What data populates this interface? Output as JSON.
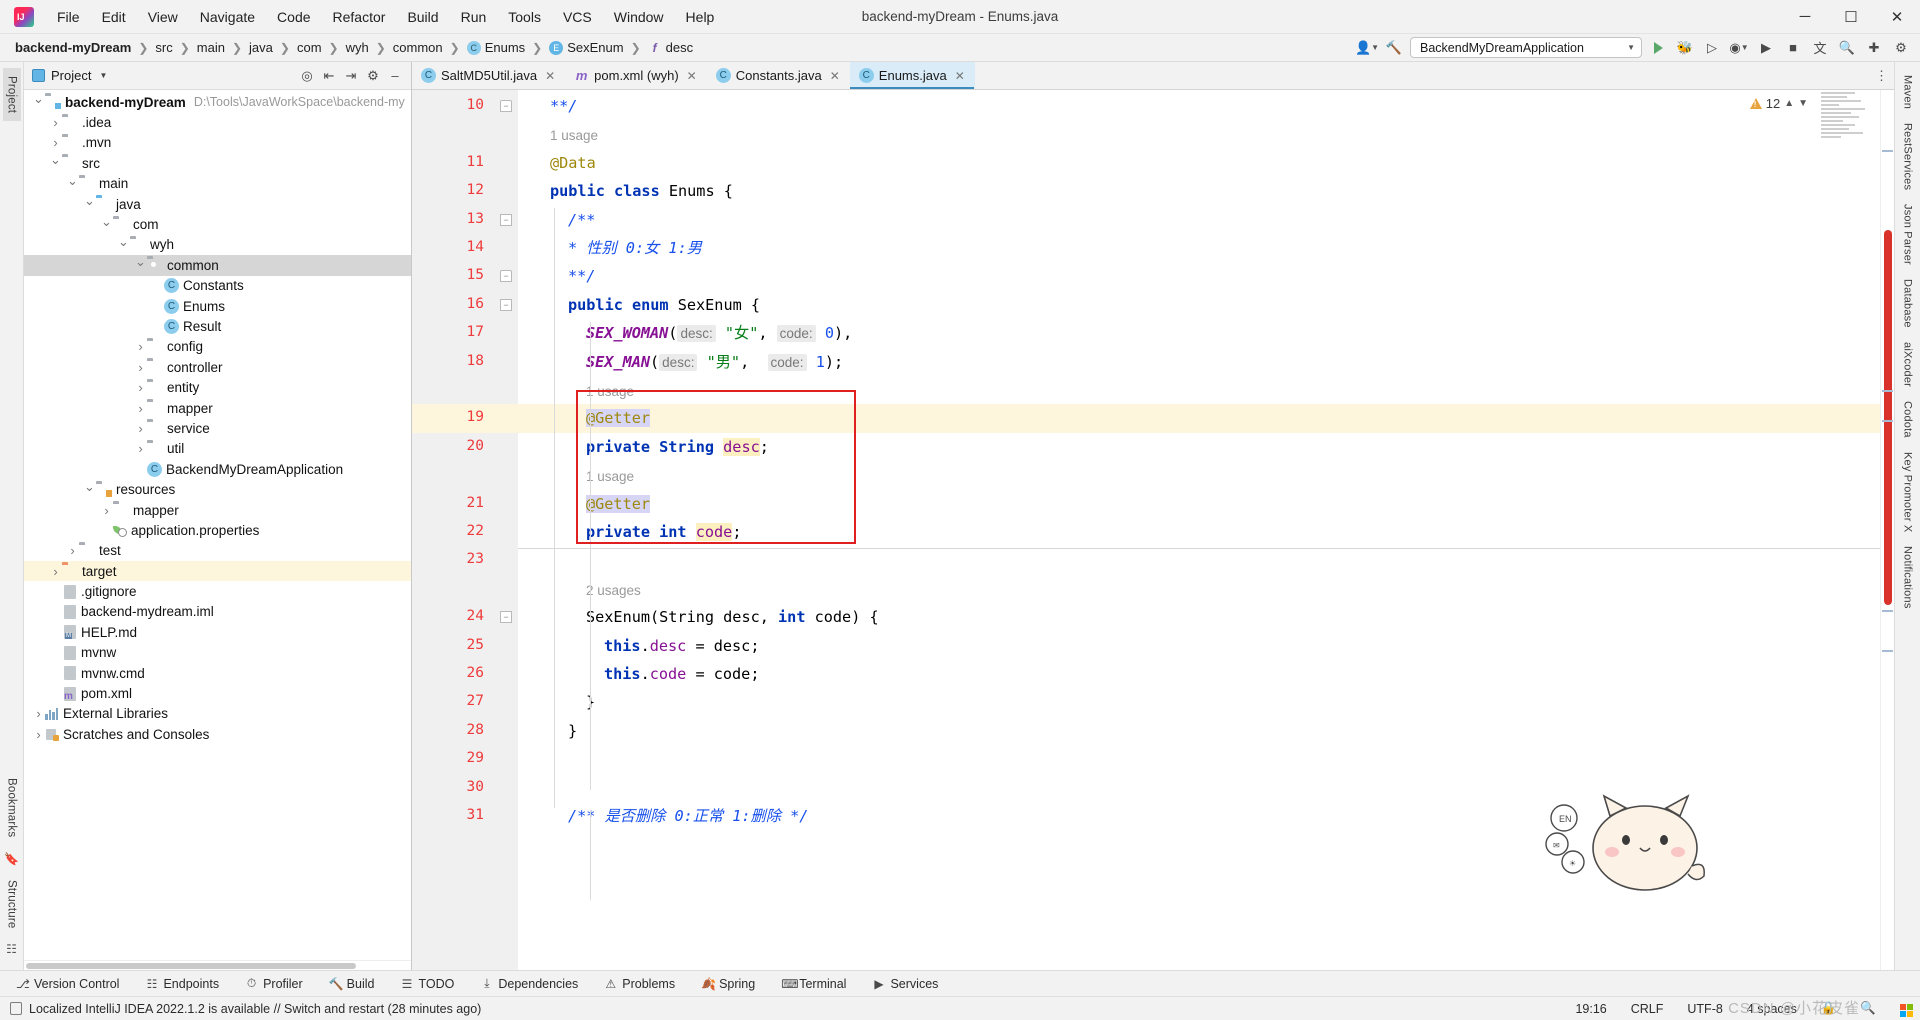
{
  "window": {
    "title": "backend-myDream - Enums.java",
    "minimize": "—",
    "maximize": "☐",
    "close": "✕"
  },
  "menu": [
    {
      "label": "File"
    },
    {
      "label": "Edit"
    },
    {
      "label": "View"
    },
    {
      "label": "Navigate"
    },
    {
      "label": "Code"
    },
    {
      "label": "Refactor"
    },
    {
      "label": "Build"
    },
    {
      "label": "Run"
    },
    {
      "label": "Tools"
    },
    {
      "label": "VCS"
    },
    {
      "label": "Window"
    },
    {
      "label": "Help"
    }
  ],
  "breadcrumb": [
    {
      "label": "backend-myDream",
      "icon": "",
      "bold": true
    },
    {
      "label": "src",
      "icon": ""
    },
    {
      "label": "main",
      "icon": ""
    },
    {
      "label": "java",
      "icon": ""
    },
    {
      "label": "com",
      "icon": ""
    },
    {
      "label": "wyh",
      "icon": ""
    },
    {
      "label": "common",
      "icon": ""
    },
    {
      "label": "Enums",
      "icon": "c"
    },
    {
      "label": "SexEnum",
      "icon": "e"
    },
    {
      "label": "desc",
      "icon": "f"
    }
  ],
  "toolbar": {
    "run_config": "BackendMyDreamApplication",
    "account_icon": "user-icon",
    "hammer_icon": "build-icon",
    "search_icon": "search-icon",
    "translate_icon": "translate-icon",
    "settings_icon": "gear-icon"
  },
  "project_panel": {
    "title": "Project",
    "root_label": "backend-myDream",
    "root_path": "D:\\Tools\\JavaWorkSpace\\backend-my",
    "tree": [
      {
        "label": "backend-myDream",
        "depth": 0,
        "arrow": "open",
        "icon": "folder-module",
        "bold": true,
        "path": "D:\\Tools\\JavaWorkSpace\\backend-my"
      },
      {
        "label": ".idea",
        "depth": 1,
        "arrow": "closed",
        "icon": "folder"
      },
      {
        "label": ".mvn",
        "depth": 1,
        "arrow": "closed",
        "icon": "folder"
      },
      {
        "label": "src",
        "depth": 1,
        "arrow": "open",
        "icon": "folder"
      },
      {
        "label": "main",
        "depth": 2,
        "arrow": "open",
        "icon": "folder"
      },
      {
        "label": "java",
        "depth": 3,
        "arrow": "open",
        "icon": "folder-source"
      },
      {
        "label": "com",
        "depth": 4,
        "arrow": "open",
        "icon": "folder-package"
      },
      {
        "label": "wyh",
        "depth": 5,
        "arrow": "open",
        "icon": "folder-package"
      },
      {
        "label": "common",
        "depth": 6,
        "arrow": "open",
        "icon": "folder-package",
        "selected": true
      },
      {
        "label": "Constants",
        "depth": 7,
        "arrow": "none",
        "icon": "class"
      },
      {
        "label": "Enums",
        "depth": 7,
        "arrow": "none",
        "icon": "class"
      },
      {
        "label": "Result",
        "depth": 7,
        "arrow": "none",
        "icon": "class"
      },
      {
        "label": "config",
        "depth": 6,
        "arrow": "closed",
        "icon": "folder-package"
      },
      {
        "label": "controller",
        "depth": 6,
        "arrow": "closed",
        "icon": "folder-package"
      },
      {
        "label": "entity",
        "depth": 6,
        "arrow": "closed",
        "icon": "folder-package"
      },
      {
        "label": "mapper",
        "depth": 6,
        "arrow": "closed",
        "icon": "folder-package"
      },
      {
        "label": "service",
        "depth": 6,
        "arrow": "closed",
        "icon": "folder-package"
      },
      {
        "label": "util",
        "depth": 6,
        "arrow": "closed",
        "icon": "folder-package"
      },
      {
        "label": "BackendMyDreamApplication",
        "depth": 6,
        "arrow": "none",
        "icon": "class-run"
      },
      {
        "label": "resources",
        "depth": 3,
        "arrow": "open",
        "icon": "folder-resources"
      },
      {
        "label": "mapper",
        "depth": 4,
        "arrow": "closed",
        "icon": "folder"
      },
      {
        "label": "application.properties",
        "depth": 4,
        "arrow": "none",
        "icon": "spring-properties"
      },
      {
        "label": "test",
        "depth": 2,
        "arrow": "closed",
        "icon": "folder"
      },
      {
        "label": "target",
        "depth": 1,
        "arrow": "closed",
        "icon": "folder-target",
        "highlight": true
      },
      {
        "label": ".gitignore",
        "depth": 1,
        "arrow": "none",
        "icon": "gitignore"
      },
      {
        "label": "backend-mydream.iml",
        "depth": 1,
        "arrow": "none",
        "icon": "iml"
      },
      {
        "label": "HELP.md",
        "depth": 1,
        "arrow": "none",
        "icon": "markdown"
      },
      {
        "label": "mvnw",
        "depth": 1,
        "arrow": "none",
        "icon": "file"
      },
      {
        "label": "mvnw.cmd",
        "depth": 1,
        "arrow": "none",
        "icon": "file"
      },
      {
        "label": "pom.xml",
        "depth": 1,
        "arrow": "none",
        "icon": "maven"
      },
      {
        "label": "External Libraries",
        "depth": 0,
        "arrow": "closed",
        "icon": "library"
      },
      {
        "label": "Scratches and Consoles",
        "depth": 0,
        "arrow": "closed",
        "icon": "scratch"
      }
    ]
  },
  "left_rail": {
    "items": [
      {
        "label": "Project",
        "selected": true
      },
      {
        "label": "Bookmarks"
      },
      {
        "label": "Structure"
      }
    ]
  },
  "right_rail": {
    "items": [
      {
        "label": "Maven"
      },
      {
        "label": "RestServices"
      },
      {
        "label": "Json Parser"
      },
      {
        "label": "Database"
      },
      {
        "label": "aiXcoder"
      },
      {
        "label": "Codota"
      },
      {
        "label": "Key Promoter X"
      },
      {
        "label": "Notifications"
      }
    ]
  },
  "editor_tabs": [
    {
      "label": "SaltMD5Util.java",
      "icon": "class",
      "active": false
    },
    {
      "label": "pom.xml (wyh)",
      "icon": "maven",
      "active": false
    },
    {
      "label": "Constants.java",
      "icon": "class",
      "active": false
    },
    {
      "label": "Enums.java",
      "icon": "class",
      "active": true
    }
  ],
  "editor": {
    "warning_count": "12",
    "file": "Enums.java",
    "first_line": 10,
    "lines": [
      {
        "num": 10,
        "indent": 1,
        "fold": "up",
        "segments": [
          {
            "t": "**/",
            "c": "cmt"
          }
        ]
      },
      {
        "num": null,
        "hint": "1 usage",
        "indent": 1
      },
      {
        "num": 11,
        "indent": 1,
        "segments": [
          {
            "t": "@Data",
            "c": "ann"
          }
        ]
      },
      {
        "num": 12,
        "indent": 1,
        "segments": [
          {
            "t": "public class ",
            "c": "kw"
          },
          {
            "t": "Enums ",
            "c": "cls"
          },
          {
            "t": "{",
            "c": "cls"
          }
        ]
      },
      {
        "num": 13,
        "indent": 2,
        "fold": "down",
        "segments": [
          {
            "t": "/**",
            "c": "cmt"
          }
        ]
      },
      {
        "num": 14,
        "indent": 2,
        "segments": [
          {
            "t": "* 性别 0:女 1:男",
            "c": "cmt"
          }
        ]
      },
      {
        "num": 15,
        "indent": 2,
        "fold": "up",
        "segments": [
          {
            "t": "**/",
            "c": "cmt"
          }
        ]
      },
      {
        "num": 16,
        "indent": 2,
        "fold": "down",
        "segments": [
          {
            "t": "public enum ",
            "c": "kw"
          },
          {
            "t": "SexEnum {",
            "c": "cls"
          }
        ]
      },
      {
        "num": 17,
        "indent": 3,
        "segments": [
          {
            "t": "SEX_WOMAN",
            "c": "enumc"
          },
          {
            "t": "(",
            "c": "cls"
          },
          {
            "t": "desc:",
            "c": "param"
          },
          {
            "t": " \"女\"",
            "c": "str"
          },
          {
            "t": ", ",
            "c": "cls"
          },
          {
            "t": "code:",
            "c": "param"
          },
          {
            "t": " 0",
            "c": "num"
          },
          {
            "t": "),",
            "c": "cls"
          }
        ]
      },
      {
        "num": 18,
        "indent": 3,
        "segments": [
          {
            "t": "SEX_MAN",
            "c": "enumc"
          },
          {
            "t": "(",
            "c": "cls"
          },
          {
            "t": "desc:",
            "c": "param"
          },
          {
            "t": " \"男\"",
            "c": "str"
          },
          {
            "t": ",  ",
            "c": "cls"
          },
          {
            "t": "code:",
            "c": "param"
          },
          {
            "t": " 1",
            "c": "num"
          },
          {
            "t": ");",
            "c": "cls"
          }
        ]
      },
      {
        "num": null,
        "hint": "1 usage",
        "indent": 3
      },
      {
        "num": 19,
        "indent": 3,
        "current": true,
        "segments": [
          {
            "t": "@Getter",
            "c": "ann hlsel"
          }
        ]
      },
      {
        "num": 20,
        "indent": 3,
        "segments": [
          {
            "t": "private String ",
            "c": "kw"
          },
          {
            "t": "desc",
            "c": "fld hlident"
          },
          {
            "t": ";",
            "c": "cls"
          }
        ]
      },
      {
        "num": null,
        "hint": "1 usage",
        "indent": 3
      },
      {
        "num": 21,
        "indent": 3,
        "segments": [
          {
            "t": "@Getter",
            "c": "ann hlsel"
          }
        ]
      },
      {
        "num": 22,
        "indent": 3,
        "segments": [
          {
            "t": "private int ",
            "c": "kw"
          },
          {
            "t": "code",
            "c": "fld hlident"
          },
          {
            "t": ";",
            "c": "cls"
          }
        ]
      },
      {
        "num": 23,
        "indent": 3,
        "segments": []
      },
      {
        "num": null,
        "hint": "2 usages",
        "indent": 3
      },
      {
        "num": 24,
        "indent": 3,
        "fold": "down",
        "segments": [
          {
            "t": "SexEnum(String ",
            "c": "cls"
          },
          {
            "t": "desc",
            "c": "cls"
          },
          {
            "t": ", ",
            "c": "cls"
          },
          {
            "t": "int ",
            "c": "kw"
          },
          {
            "t": "code",
            "c": "cls"
          },
          {
            "t": ") {",
            "c": "cls"
          }
        ]
      },
      {
        "num": 25,
        "indent": 4,
        "segments": [
          {
            "t": "this",
            "c": "kw"
          },
          {
            "t": ".",
            "c": "cls"
          },
          {
            "t": "desc",
            "c": "fld"
          },
          {
            "t": " = desc;",
            "c": "cls"
          }
        ]
      },
      {
        "num": 26,
        "indent": 4,
        "segments": [
          {
            "t": "this",
            "c": "kw"
          },
          {
            "t": ".",
            "c": "cls"
          },
          {
            "t": "code",
            "c": "fld"
          },
          {
            "t": " = code;",
            "c": "cls"
          }
        ]
      },
      {
        "num": 27,
        "indent": 3,
        "segments": [
          {
            "t": "}",
            "c": "cls"
          }
        ]
      },
      {
        "num": 28,
        "indent": 2,
        "segments": [
          {
            "t": "}",
            "c": "cls"
          }
        ]
      },
      {
        "num": 29,
        "indent": 1,
        "segments": []
      },
      {
        "num": 30,
        "indent": 1,
        "segments": []
      },
      {
        "num": 31,
        "indent": 2,
        "segments": [
          {
            "t": "/** 是否删除 0:正常 1:删除 */",
            "c": "cmt"
          }
        ]
      }
    ]
  },
  "bottom_tools": [
    {
      "label": "Version Control",
      "icon": "branch-icon"
    },
    {
      "label": "Endpoints",
      "icon": "endpoints-icon"
    },
    {
      "label": "Profiler",
      "icon": "profiler-icon"
    },
    {
      "label": "Build",
      "icon": "build-icon"
    },
    {
      "label": "TODO",
      "icon": "todo-icon"
    },
    {
      "label": "Dependencies",
      "icon": "dependencies-icon"
    },
    {
      "label": "Problems",
      "icon": "problems-icon"
    },
    {
      "label": "Spring",
      "icon": "spring-icon"
    },
    {
      "label": "Terminal",
      "icon": "terminal-icon"
    },
    {
      "label": "Services",
      "icon": "services-icon"
    }
  ],
  "status_bar": {
    "message": "Localized IntelliJ IDEA 2022.1.2 is available // Switch and restart (28 minutes ago)",
    "caret": "19:16",
    "line_separator": "CRLF",
    "encoding": "UTF-8",
    "indent": "4 spaces",
    "watermark": "CSDN @小花皮雀"
  }
}
